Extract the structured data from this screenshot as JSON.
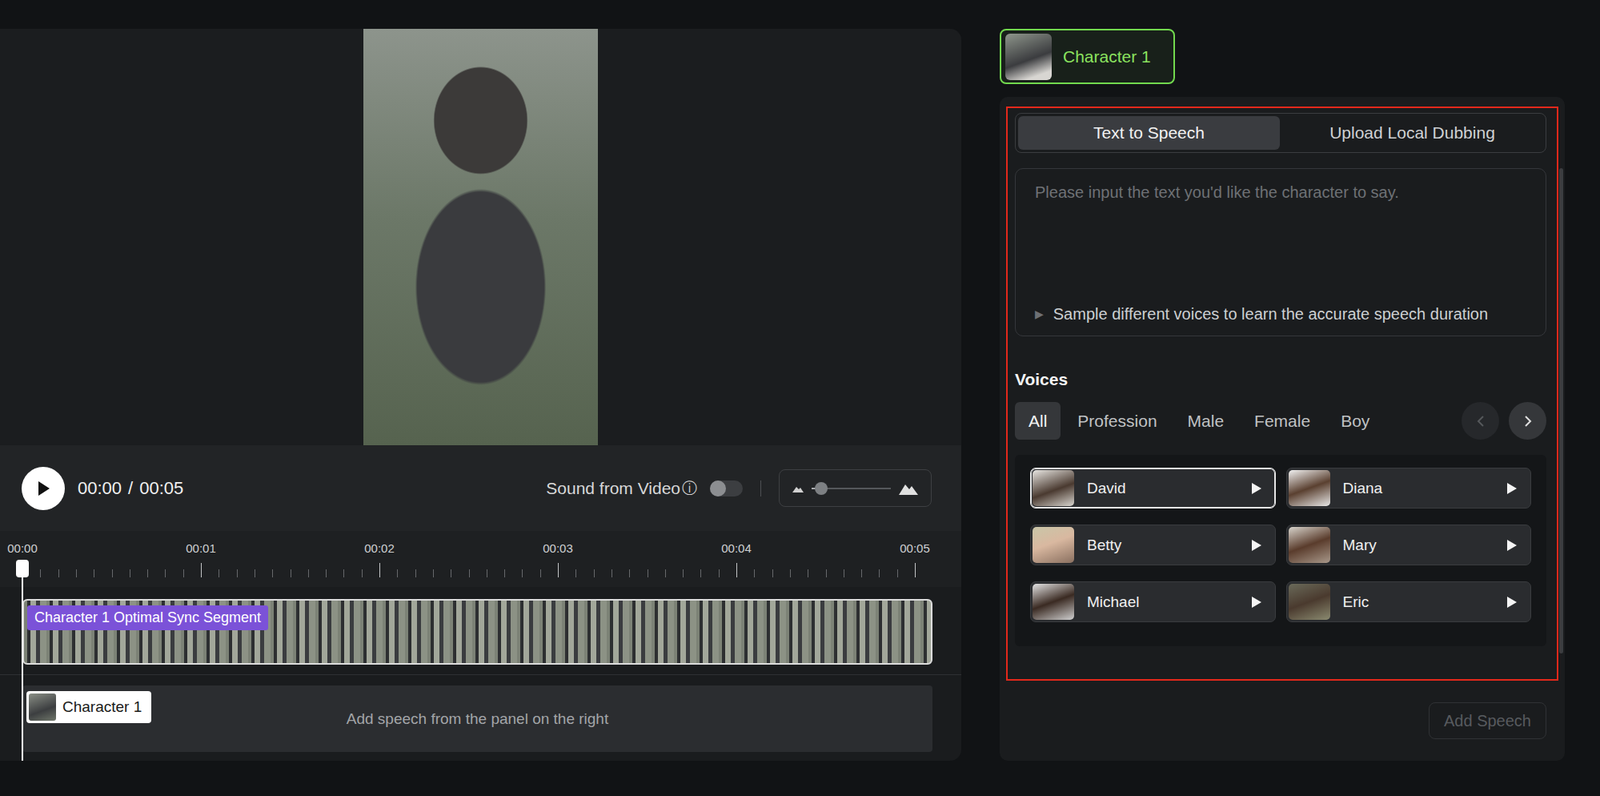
{
  "preview": {
    "time": {
      "current": "00:00",
      "separator": "/",
      "total": "00:05"
    },
    "sound_from_video": {
      "label": "Sound from Video",
      "info": "ⓘ",
      "on": false
    },
    "volume": {
      "level": 0.12
    }
  },
  "timeline": {
    "ticks": [
      "00:00",
      "00:01",
      "00:02",
      "00:03",
      "00:04",
      "00:05"
    ],
    "playhead": {
      "level": 0
    },
    "video_track": {
      "label": "Character 1 Optimal Sync Segment"
    },
    "audio_track": {
      "character": "Character 1",
      "hint": "Add speech from the panel on the right"
    }
  },
  "character_tabs": [
    {
      "label": "Character 1",
      "selected": true
    }
  ],
  "mode_tabs": [
    {
      "label": "Text to Speech",
      "selected": true
    },
    {
      "label": "Upload Local Dubbing",
      "selected": false
    }
  ],
  "text_input": {
    "placeholder": "Please input the text you'd like the character to say.",
    "sample_icon": "▶",
    "sample_hint": "Sample different voices to learn the accurate speech duration"
  },
  "voices": {
    "title": "Voices",
    "filters": [
      {
        "label": "All",
        "selected": true
      },
      {
        "label": "Profession",
        "selected": false
      },
      {
        "label": "Male",
        "selected": false
      },
      {
        "label": "Female",
        "selected": false
      },
      {
        "label": "Boy",
        "selected": false
      }
    ],
    "pager": {
      "prev_disabled": true,
      "next_disabled": false
    },
    "items": [
      {
        "name": "David",
        "selected": true
      },
      {
        "name": "Diana",
        "selected": false
      },
      {
        "name": "Betty",
        "selected": false
      },
      {
        "name": "Mary",
        "selected": false
      },
      {
        "name": "Michael",
        "selected": false
      },
      {
        "name": "Eric",
        "selected": false
      }
    ]
  },
  "add_speech": {
    "label": "Add Speech",
    "disabled": true
  }
}
